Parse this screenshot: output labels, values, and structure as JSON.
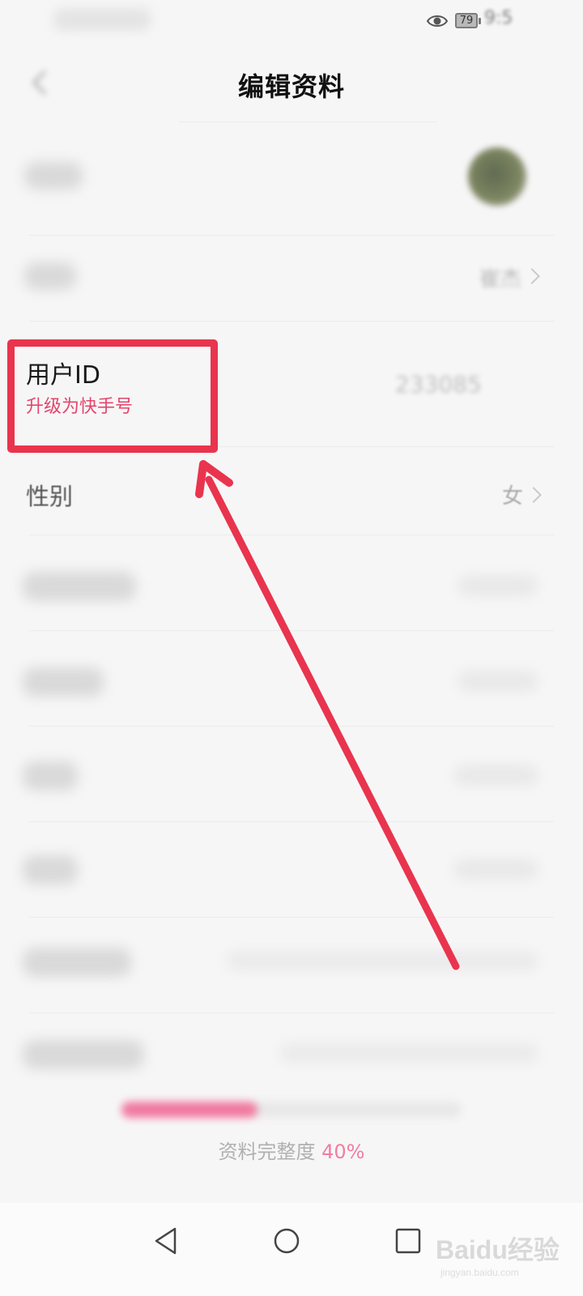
{
  "status_bar": {
    "battery_level": "79",
    "time": "9:5",
    "icons": [
      "eye-icon",
      "battery-icon"
    ]
  },
  "header": {
    "title": "编辑资料",
    "back_icon": "back-arrow-icon"
  },
  "fields": {
    "nickname_value": "崔杰",
    "user_id_label": "用户ID",
    "user_id_value": "233085",
    "upgrade_link": "升级为快手号",
    "gender_label": "性别",
    "gender_value": "女"
  },
  "profile_completeness": {
    "label": "资料完整度",
    "percent_text": "40%",
    "progress_fraction": 0.4
  },
  "annotation": {
    "box_color": "#e9344e",
    "arrow_color": "#e9344e"
  },
  "nav_bar": {
    "icons": [
      "back-triangle-icon",
      "home-circle-icon",
      "recent-square-icon"
    ]
  },
  "watermark": {
    "logo": "Baidu经验",
    "sub": "jingyan.baidu.com"
  },
  "colors": {
    "accent": "#e2466b",
    "background": "#f7f6f7"
  }
}
